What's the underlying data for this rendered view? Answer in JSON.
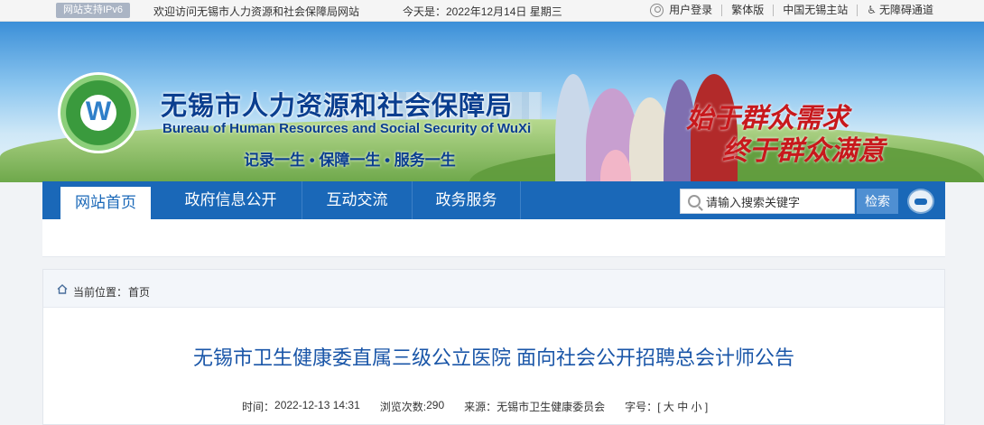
{
  "topbar": {
    "ipv6_badge": "网站支持IPv6",
    "welcome": "欢迎访问无锡市人力资源和社会保障局网站",
    "today": "今天是：2022年12月14日 星期三",
    "links": [
      "用户登录",
      "繁体版",
      "中国无锡主站",
      "无障碍通道"
    ]
  },
  "banner": {
    "title_cn": "无锡市人力资源和社会保障局",
    "title_en": "Bureau of Human Resources and Social Security of WuXi",
    "slogan": "记录一生 • 保障一生 • 服务一生",
    "motto_line1": "始于群众需求",
    "motto_line2": "终于群众满意"
  },
  "nav": {
    "tabs": [
      "网站首页",
      "政府信息公开",
      "互动交流",
      "政务服务"
    ],
    "search_placeholder": "请输入搜索关键字",
    "search_button": "检索"
  },
  "breadcrumb": {
    "label": "当前位置：",
    "home": "首页"
  },
  "article": {
    "title": "无锡市卫生健康委直属三级公立医院 面向社会公开招聘总会计师公告",
    "time_label": "时间：",
    "time": "2022-12-13 14:31",
    "views_label": "浏览次数:",
    "views": "290",
    "source_label": "来源：",
    "source": "无锡市卫生健康委员会",
    "fontsize_label": "字号：",
    "fontsize_options": "[ 大 中 小 ]"
  },
  "colors": {
    "nav_blue": "#1a68b8",
    "title_blue": "#1a56a8",
    "motto_red": "#c8181c"
  }
}
